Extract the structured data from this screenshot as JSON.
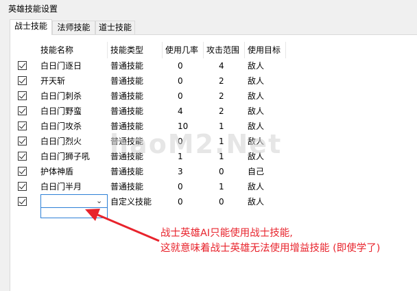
{
  "window": {
    "title": "英雄技能设置"
  },
  "tabs": [
    {
      "label": "战士技能",
      "active": true
    },
    {
      "label": "法师技能",
      "active": false
    },
    {
      "label": "道士技能",
      "active": false
    }
  ],
  "table": {
    "columns": [
      "技能名称",
      "技能类型",
      "使用几率",
      "攻击范围",
      "使用目标"
    ],
    "rows": [
      {
        "checked": true,
        "name": "白日门逐日",
        "type": "普通技能",
        "rate": "0",
        "range": "4",
        "target": "敌人"
      },
      {
        "checked": true,
        "name": "开天斩",
        "type": "普通技能",
        "rate": "0",
        "range": "2",
        "target": "敌人"
      },
      {
        "checked": true,
        "name": "白日门刺杀",
        "type": "普通技能",
        "rate": "0",
        "range": "2",
        "target": "敌人"
      },
      {
        "checked": true,
        "name": "白日门野蛮",
        "type": "普通技能",
        "rate": "4",
        "range": "2",
        "target": "敌人"
      },
      {
        "checked": true,
        "name": "白日门攻杀",
        "type": "普通技能",
        "rate": "10",
        "range": "1",
        "target": "敌人"
      },
      {
        "checked": true,
        "name": "白日门烈火",
        "type": "普通技能",
        "rate": "0",
        "range": "1",
        "target": "敌人"
      },
      {
        "checked": true,
        "name": "白日门狮子吼",
        "type": "普通技能",
        "rate": "1",
        "range": "1",
        "target": "敌人"
      },
      {
        "checked": true,
        "name": "护体神盾",
        "type": "普通技能",
        "rate": "3",
        "range": "0",
        "target": "自己"
      },
      {
        "checked": true,
        "name": "白日门半月",
        "type": "普通技能",
        "rate": "0",
        "range": "1",
        "target": "敌人"
      },
      {
        "checked": true,
        "name": "",
        "type": "自定义技能",
        "rate": "0",
        "range": "0",
        "target": "敌人"
      }
    ]
  },
  "dropdown": {
    "value": "",
    "arrow_icon": "chevron-down-icon"
  },
  "watermark": "haoM2.Net",
  "annotation": {
    "line1": "战士英雄AI只能使用战士技能,",
    "line2": "这就意味着战士英雄无法使用增益技能 (即使学了)",
    "color": "#e8232c"
  }
}
